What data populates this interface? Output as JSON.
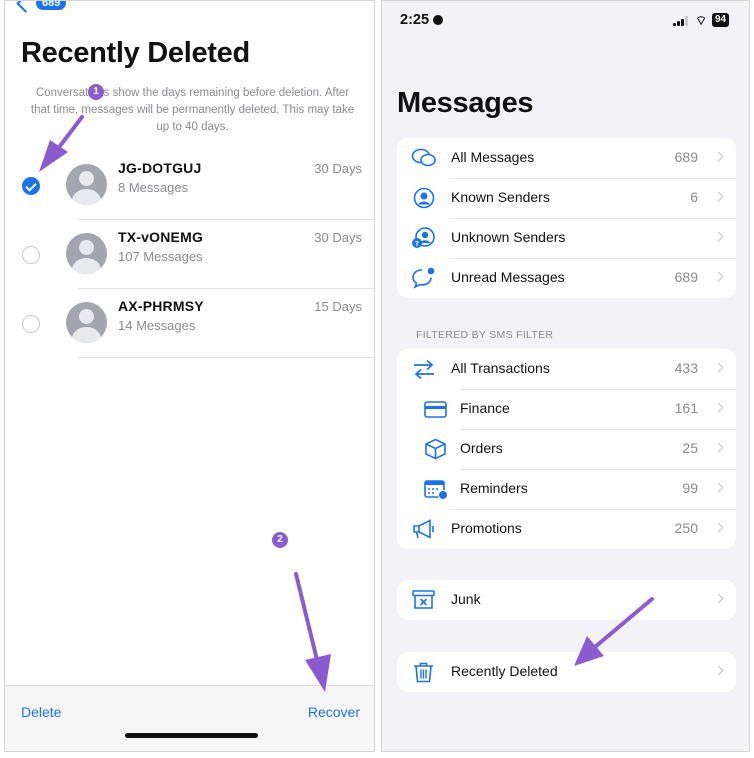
{
  "left": {
    "back_badge": "689",
    "title": "Recently Deleted",
    "info_text": "Conversations show the days remaining before deletion. After that time, messages will be permanently deleted. This may take up to 40 days.",
    "conversations": [
      {
        "name": "JG-DOTGUJ",
        "count": "8 Messages",
        "days": "30 Days",
        "selected": true
      },
      {
        "name": "TX-vONEMG",
        "count": "107 Messages",
        "days": "30 Days",
        "selected": false
      },
      {
        "name": "AX-PHRMSY",
        "count": "14 Messages",
        "days": "15 Days",
        "selected": false
      }
    ],
    "delete_label": "Delete",
    "recover_label": "Recover",
    "step1": "1",
    "step2": "2"
  },
  "right": {
    "status_time": "2:25",
    "battery": "94",
    "wifi": "⌔",
    "title": "Messages",
    "main_filters": [
      {
        "label": "All Messages",
        "count": "689",
        "icon": "speech-bubbles-icon"
      },
      {
        "label": "Known Senders",
        "count": "6",
        "icon": "person-circle-icon"
      },
      {
        "label": "Unknown Senders",
        "count": "",
        "icon": "person-question-icon"
      },
      {
        "label": "Unread Messages",
        "count": "689",
        "icon": "unread-bubble-icon"
      }
    ],
    "section_header": "FILTERED BY SMS FILTER",
    "sms_filters": [
      {
        "label": "All Transactions",
        "count": "433",
        "icon": "transfer-arrows-icon"
      },
      {
        "label": "Finance",
        "count": "161",
        "icon": "card-icon"
      },
      {
        "label": "Orders",
        "count": "25",
        "icon": "box-icon"
      },
      {
        "label": "Reminders",
        "count": "99",
        "icon": "calendar-icon"
      },
      {
        "label": "Promotions",
        "count": "250",
        "icon": "megaphone-icon"
      }
    ],
    "junk_label": "Junk",
    "recently_deleted_label": "Recently Deleted"
  },
  "colors": {
    "accent": "#1a73e8",
    "annotation": "#8b5ccf",
    "secondary_text": "#8a8a8e",
    "grouped_background": "#f2f2f7"
  }
}
